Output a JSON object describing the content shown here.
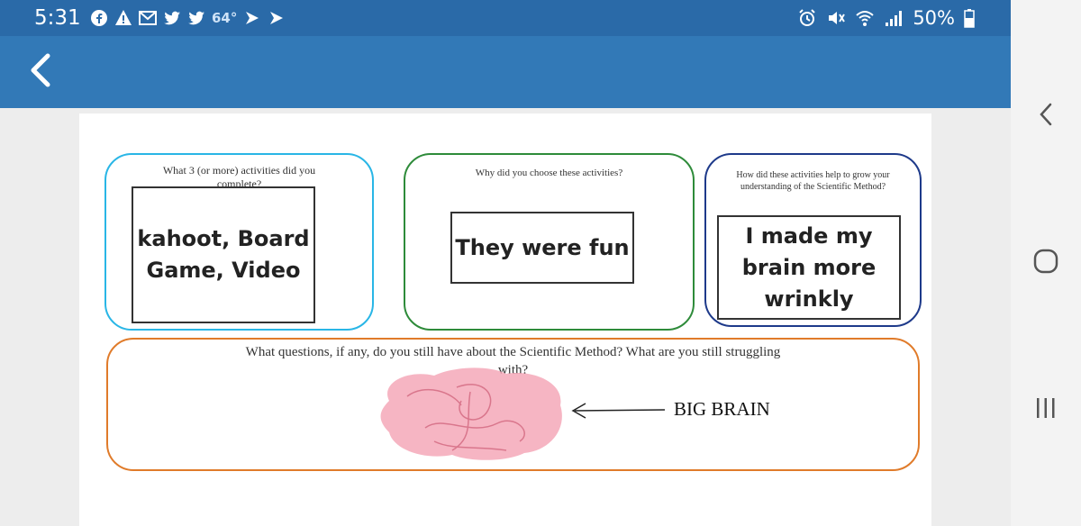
{
  "status_bar": {
    "time": "5:31",
    "temperature": "64°",
    "battery_percent": "50%",
    "notification_icons": [
      "facebook-icon",
      "warning-icon",
      "gmail-icon",
      "twitter-icon",
      "twitter-icon",
      "feedly-icon",
      "feedly-icon"
    ],
    "system_icons": [
      "alarm-icon",
      "mute-vibrate-icon",
      "wifi-icon",
      "signal-icon",
      "battery-icon"
    ]
  },
  "app_bar": {
    "back_icon": "chevron-left-icon",
    "color": "#3279b7"
  },
  "slide": {
    "cards": [
      {
        "question": "What 3 (or more) activities did you complete?",
        "answer": "kahoot, Board Game, Video",
        "border_color": "#29b6e6"
      },
      {
        "question": "Why did you choose these activities?",
        "answer": "They were fun",
        "border_color": "#2e8b3a"
      },
      {
        "question": "How did these activities help to grow your understanding of the Scientific Method?",
        "answer": "I made my brain more wrinkly",
        "border_color": "#1e3a8a"
      }
    ],
    "bottom_card": {
      "question": "What questions, if any, do you still have about the Scientific Method?  What are you still struggling with?",
      "annotation": "BIG BRAIN",
      "border_color": "#e07b2a",
      "scribble_color": "#f4a8b8"
    }
  },
  "nav_bar": {
    "icons": [
      "nav-back-icon",
      "home-icon",
      "recent-apps-icon"
    ]
  }
}
